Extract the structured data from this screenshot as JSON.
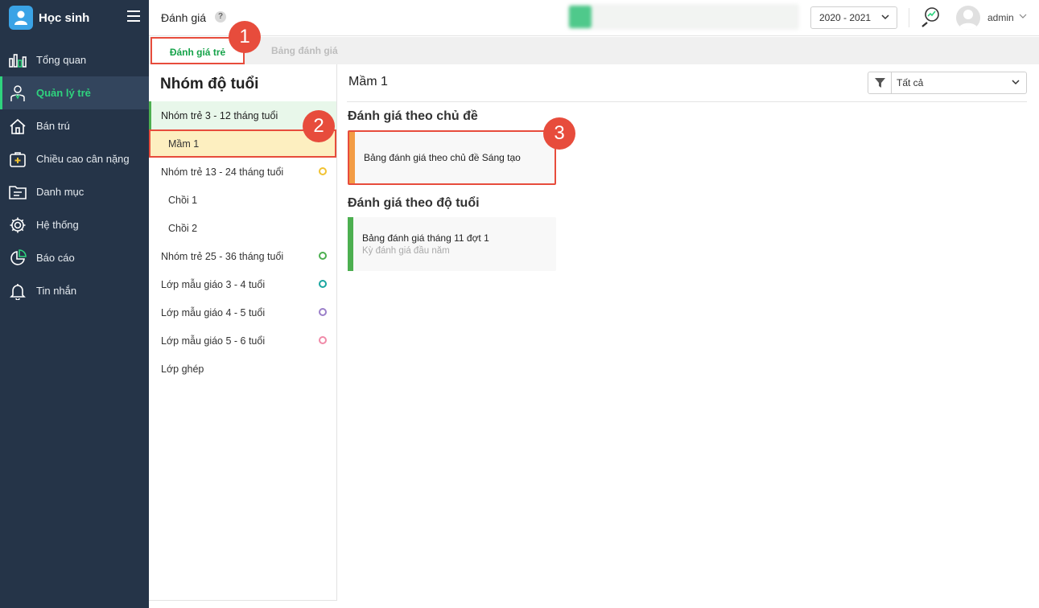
{
  "app": {
    "title": "Học sinh"
  },
  "sidebar": {
    "items": [
      {
        "label": "Tổng quan"
      },
      {
        "label": "Quản lý trẻ"
      },
      {
        "label": "Bán trú"
      },
      {
        "label": "Chiều cao cân nặng"
      },
      {
        "label": "Danh mục"
      },
      {
        "label": "Hệ thống"
      },
      {
        "label": "Báo cáo"
      },
      {
        "label": "Tin nhắn"
      }
    ]
  },
  "header": {
    "title": "Đánh giá",
    "help": "?",
    "year": "2020 - 2021",
    "user": "admin"
  },
  "tabs": [
    {
      "label": "Đánh giá trẻ"
    },
    {
      "label": "Bảng đánh giá"
    }
  ],
  "age_panel": {
    "heading": "Nhóm độ tuổi",
    "items": [
      {
        "label": "Nhóm trẻ 3 - 12 tháng tuổi",
        "dot": "#4caf50"
      },
      {
        "label": "Mầm 1"
      },
      {
        "label": "Nhóm trẻ 13 - 24 tháng tuổi",
        "dot": "#f1c232"
      },
      {
        "label": "Chồi 1"
      },
      {
        "label": "Chồi 2"
      },
      {
        "label": "Nhóm trẻ 25 - 36 tháng tuổi",
        "dot": "#4caf50"
      },
      {
        "label": "Lớp mẫu giáo 3 - 4 tuổi",
        "dot": "#1aa6a0"
      },
      {
        "label": "Lớp mẫu giáo 4 - 5 tuổi",
        "dot": "#9b7fc9"
      },
      {
        "label": "Lớp mẫu giáo 5 - 6 tuổi",
        "dot": "#f08aa8"
      },
      {
        "label": "Lớp ghép"
      }
    ]
  },
  "content": {
    "title": "Mầm 1",
    "filter": "Tất cả",
    "sections": [
      {
        "title": "Đánh giá theo chủ đề",
        "cards": [
          {
            "title": "Bảng đánh giá theo chủ đề Sáng tạo",
            "accent": "#f39c45"
          }
        ]
      },
      {
        "title": "Đánh giá theo độ tuổi",
        "cards": [
          {
            "title": "Bảng đánh giá tháng 11 đợt 1",
            "subtitle": "Kỳ đánh giá đầu năm",
            "accent": "#4caf50"
          }
        ]
      }
    ]
  },
  "callouts": [
    "1",
    "2",
    "3"
  ],
  "colors": {
    "sidebar_bg": "#253448",
    "accent_green": "#2fd37e",
    "highlight_red": "#e74c3c"
  }
}
